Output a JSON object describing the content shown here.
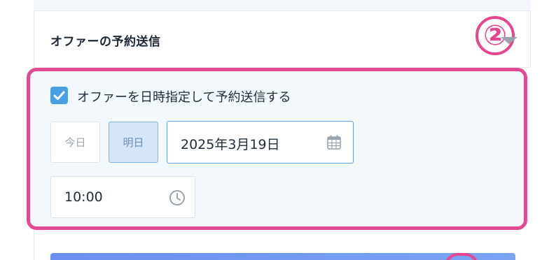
{
  "section": {
    "title": "オファーの予約送信",
    "step_marker": "②"
  },
  "schedule": {
    "checkbox_label": "オファーを日時指定して予約送信する",
    "checkbox_checked": true,
    "today_label": "今日",
    "tomorrow_label": "明日",
    "date_value": "2025年3月19日",
    "time_value": "10:00"
  },
  "icons": {
    "collapse": "chevron-down-icon",
    "checkbox": "check-icon",
    "date": "calendar-icon",
    "time": "clock-icon"
  },
  "colors": {
    "highlight": "#e24a93",
    "checkbox": "#4a9fe3",
    "selected_day": "#d4e6f8",
    "date_border": "#5ea4e0",
    "primary_button": "#6b8ff0"
  }
}
